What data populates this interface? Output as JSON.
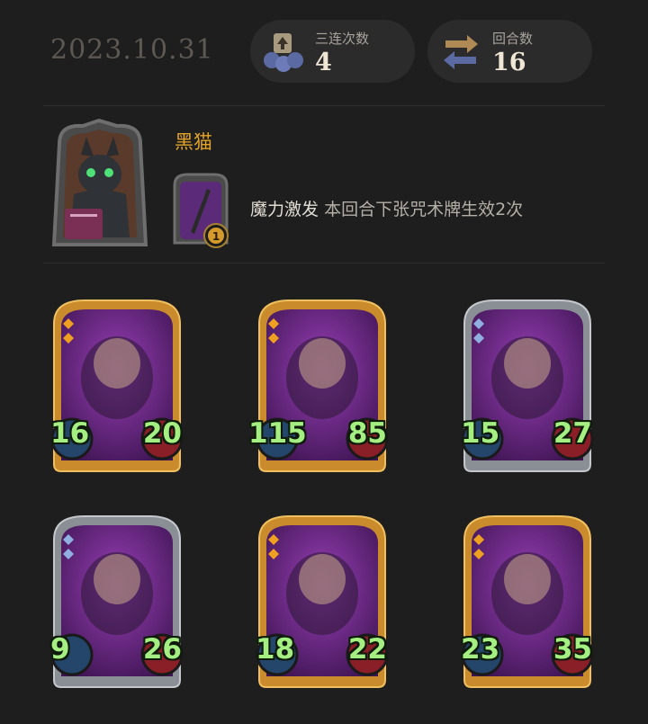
{
  "header": {
    "date": "2023.10.31",
    "stats": [
      {
        "label": "三连次数",
        "value": "4",
        "icon": "triple-merge-icon"
      },
      {
        "label": "回合数",
        "value": "16",
        "icon": "turn-cycle-icon"
      }
    ]
  },
  "hero": {
    "name": "黑猫",
    "skill_keyword": "魔力激发",
    "skill_text": "本回合下张咒术牌生效2次",
    "skill_badge": "1"
  },
  "cards": [
    {
      "name": "archer-card",
      "attack": "16",
      "health": "20",
      "rarity": "gold",
      "tier": "gold"
    },
    {
      "name": "leaf-girl-card",
      "attack": "115",
      "health": "85",
      "rarity": "gold",
      "tier": "gold"
    },
    {
      "name": "witch-card",
      "attack": "15",
      "health": "27",
      "rarity": "blue",
      "tier": "silver"
    },
    {
      "name": "scarecrow-card-silver",
      "attack": "9",
      "health": "26",
      "rarity": "blue",
      "tier": "silver"
    },
    {
      "name": "scarecrow-card-gold",
      "attack": "18",
      "health": "22",
      "rarity": "gold",
      "tier": "gold"
    },
    {
      "name": "octopus-captain-card",
      "attack": "23",
      "health": "35",
      "rarity": "gold",
      "tier": "gold"
    }
  ],
  "colors": {
    "accent_gold": "#e3a328",
    "stat_green": "#a4ee82",
    "card_purple": "#6b2a86"
  }
}
